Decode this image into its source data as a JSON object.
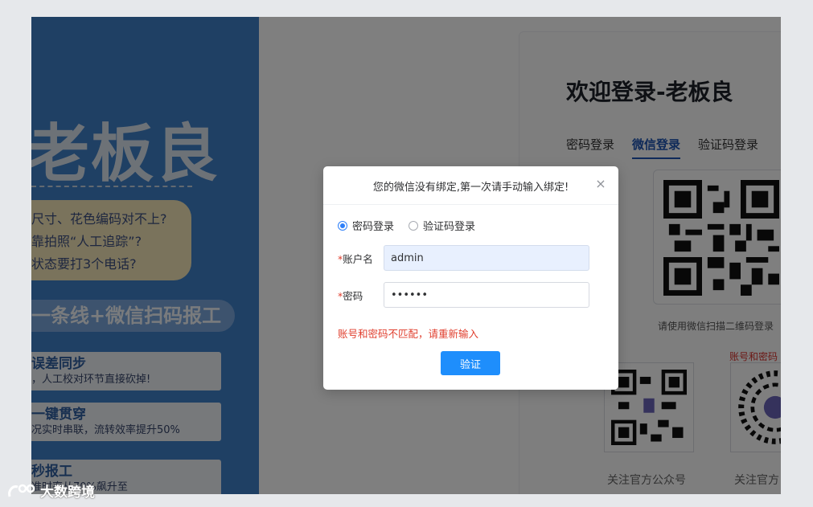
{
  "banner": {
    "brand": "老板良",
    "pain_points": [
      "尺寸、花色编码对不上?",
      "靠拍照“人工追踪”?",
      "状态要打3个电话?"
    ],
    "slogan": "一条线+微信扫码报工",
    "cards": [
      {
        "title": "误差同步",
        "subtitle": "，人工校对环节直接砍掉!"
      },
      {
        "title": "一键贯穿",
        "subtitle": "况实时串联，流转效率提升50%"
      },
      {
        "title": "秒报工",
        "subtitle": "准时率从70%飙升至"
      }
    ],
    "bg_color": "#3f80c9"
  },
  "login": {
    "title": "欢迎登录-老板良",
    "tabs": [
      {
        "label": "密码登录",
        "active": false
      },
      {
        "label": "微信登录",
        "active": true
      },
      {
        "label": "验证码登录",
        "active": false
      }
    ],
    "qr_hint": "请使用微信扫描二维码登录",
    "error_text": "账号和密码",
    "follow_labels": [
      "关注官方公众号",
      "关注官方"
    ]
  },
  "dialog": {
    "title": "您的微信没有绑定,第一次请手动输入绑定!",
    "close_icon": "close-icon",
    "radio_options": [
      {
        "label": "密码登录",
        "checked": true
      },
      {
        "label": "验证码登录",
        "checked": false
      }
    ],
    "account": {
      "required_mark": "*",
      "label": "账户名",
      "value": "admin"
    },
    "password": {
      "required_mark": "*",
      "label": "密码",
      "value": "xxxxxx"
    },
    "error": "账号和密码不匹配，请重新输入",
    "verify_label": "验证",
    "accent_color": "#1e8efc",
    "error_color": "#e03e2d"
  },
  "watermark": {
    "text": "大数跨境"
  }
}
